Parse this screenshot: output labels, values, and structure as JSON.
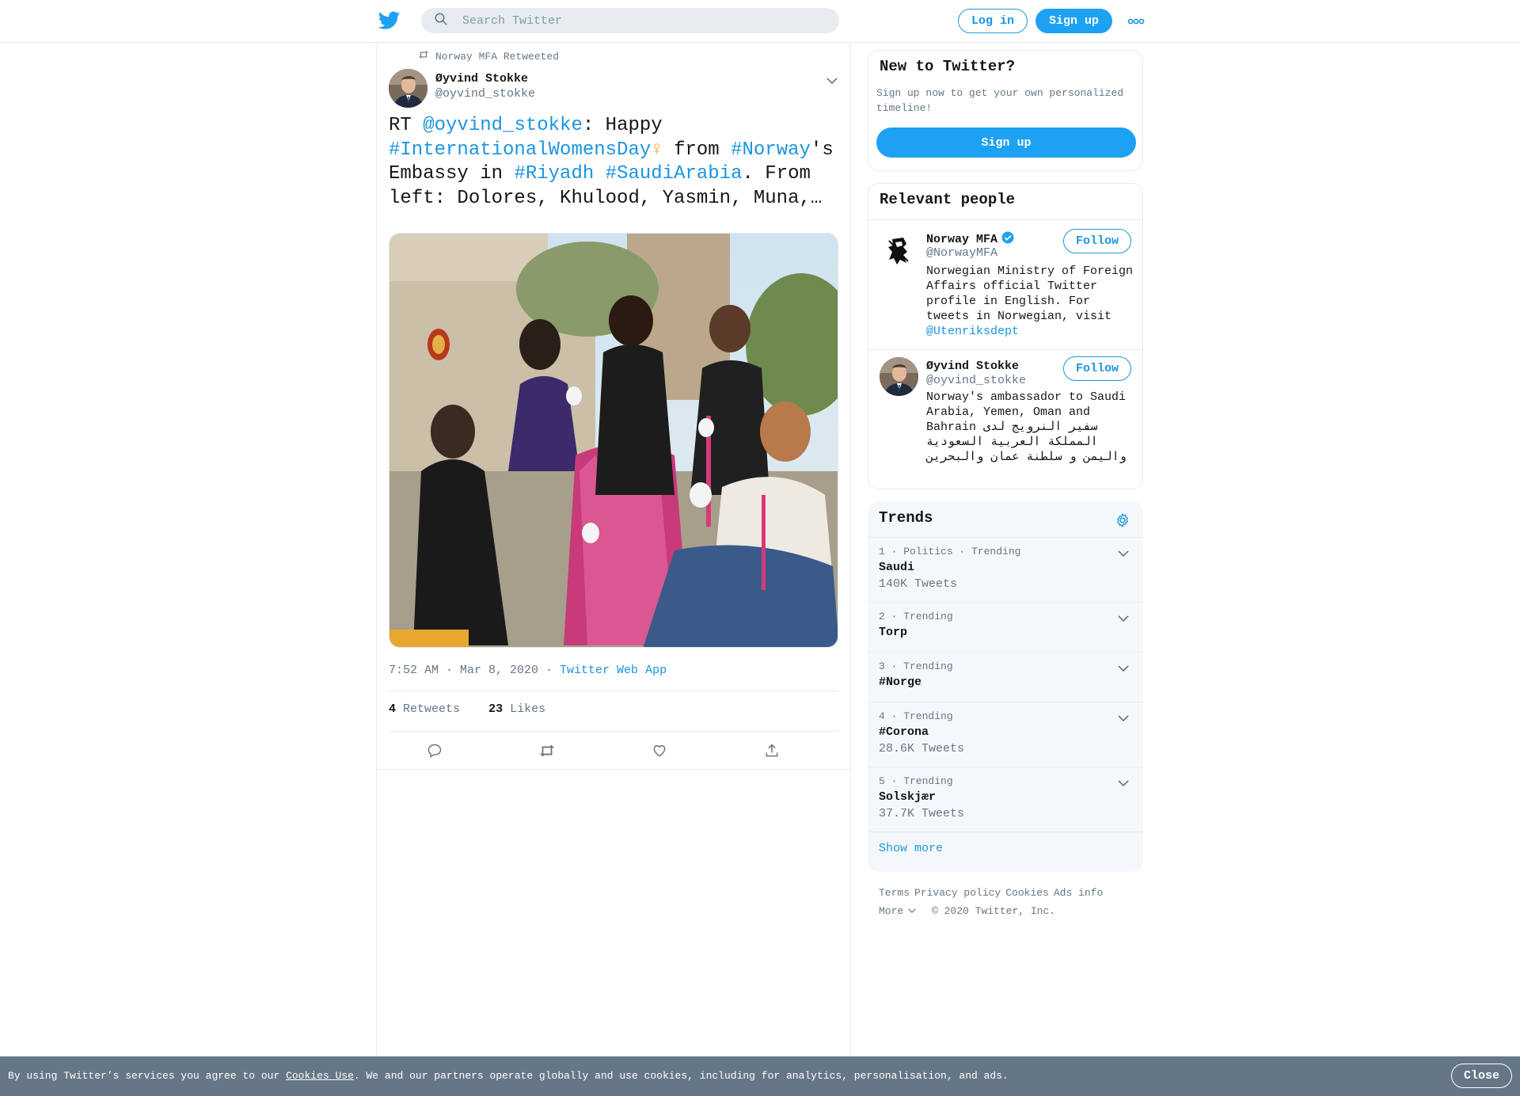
{
  "header": {
    "search_placeholder": "Search Twitter",
    "login_label": "Log in",
    "signup_label": "Sign up"
  },
  "tweet": {
    "retweeted_by": "Norway MFA Retweeted",
    "author_name": "Øyvind Stokke",
    "author_handle": "@oyvind_stokke",
    "text_parts": {
      "p1": "RT ",
      "m1": "@oyvind_stokke",
      "p2": ": Happy ",
      "h1": "#InternationalWomensDay",
      "emoji": "♀",
      "p3": " from ",
      "h2": "#Norway",
      "p4": "'s Embassy in ",
      "h3": "#Riyadh",
      "p5": " ",
      "h4": "#SaudiArabia",
      "p6": ". From left: Dolores, Khulood, Yasmin, Muna,…"
    },
    "time": "7:52 AM · Mar 8, 2020",
    "source_sep": " · ",
    "source": "Twitter Web App",
    "retweets_count": "4",
    "retweets_label": "Retweets",
    "likes_count": "23",
    "likes_label": "Likes"
  },
  "sidebar": {
    "new_title": "New to Twitter?",
    "new_text": "Sign up now to get your own personalized timeline!",
    "signup_label": "Sign up",
    "people_title": "Relevant people",
    "people": [
      {
        "name": "Norway MFA",
        "handle": "@NorwayMFA",
        "bio": "Norwegian Ministry of Foreign Affairs official Twitter profile in English. For tweets in Norwegian, visit ",
        "bio_link": "@Utenriksdept",
        "follow_label": "Follow",
        "verified": true
      },
      {
        "name": "Øyvind Stokke",
        "handle": "@oyvind_stokke",
        "bio": "Norway's ambassador to Saudi Arabia, Yemen, Oman and Bahrain سفير النرويج لدى المملكة العربية السعودية واليمن و سلطنة عمان والبحرين",
        "follow_label": "Follow"
      }
    ],
    "trends_title": "Trends",
    "trends": [
      {
        "meta": "1 · Politics · Trending",
        "name": "Saudi",
        "count": "140K Tweets"
      },
      {
        "meta": "2 · Trending",
        "name": "Torp",
        "count": ""
      },
      {
        "meta": "3 · Trending",
        "name": "#Norge",
        "count": ""
      },
      {
        "meta": "4 · Trending",
        "name": "#Corona",
        "count": "28.6K Tweets"
      },
      {
        "meta": "5 · Trending",
        "name": "Solskjær",
        "count": "37.7K Tweets"
      }
    ],
    "show_more": "Show more",
    "footer": {
      "terms": "Terms",
      "privacy": "Privacy policy",
      "cookies": "Cookies",
      "ads": "Ads info",
      "more": "More",
      "copyright": "© 2020 Twitter, Inc."
    }
  },
  "cookie_bar": {
    "text_before": "By using Twitter’s services you agree to our ",
    "link": "Cookies Use",
    "text_after": ". We and our partners operate globally and use cookies, including for analytics, personalisation, and ads.",
    "close_label": "Close"
  },
  "colors": {
    "accent": "#1da1f2",
    "link": "#1b95e0",
    "muted": "#657786",
    "cookie_bar": "#657786"
  },
  "icons": [
    "twitter-bird-icon",
    "search-icon",
    "more-dots-icon",
    "retweet-icon",
    "chevron-down-icon",
    "reply-icon",
    "like-icon",
    "share-icon",
    "verified-badge-icon",
    "gear-icon"
  ]
}
